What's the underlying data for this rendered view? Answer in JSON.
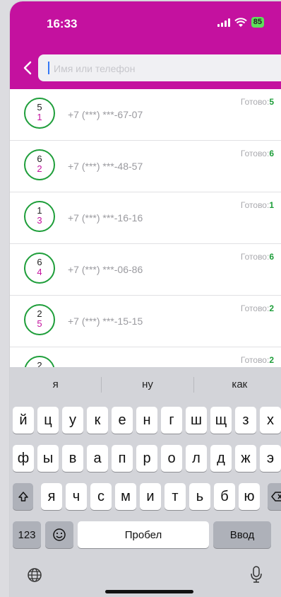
{
  "status_bar": {
    "time": "16:33",
    "battery": "85"
  },
  "search": {
    "placeholder": "Имя или телефон",
    "value": ""
  },
  "contacts": [
    {
      "count_top": "5",
      "count_bottom": "1",
      "phone": "+7 (***) ***-67-07",
      "status_label": "Готово:",
      "status_value": "5"
    },
    {
      "count_top": "6",
      "count_bottom": "2",
      "phone": "+7 (***) ***-48-57",
      "status_label": "Готово:",
      "status_value": "6"
    },
    {
      "count_top": "1",
      "count_bottom": "3",
      "phone": "+7 (***) ***-16-16",
      "status_label": "Готово:",
      "status_value": "1"
    },
    {
      "count_top": "6",
      "count_bottom": "4",
      "phone": "+7 (***) ***-06-86",
      "status_label": "Готово:",
      "status_value": "6"
    },
    {
      "count_top": "2",
      "count_bottom": "5",
      "phone": "+7 (***) ***-15-15",
      "status_label": "Готово:",
      "status_value": "2"
    },
    {
      "count_top": "2",
      "count_bottom": "",
      "phone": "",
      "status_label": "Готово:",
      "status_value": "2"
    }
  ],
  "keyboard": {
    "suggestions": [
      "я",
      "ну",
      "как"
    ],
    "row1": [
      "й",
      "ц",
      "у",
      "к",
      "е",
      "н",
      "г",
      "ш",
      "щ",
      "з",
      "х"
    ],
    "row2": [
      "ф",
      "ы",
      "в",
      "а",
      "п",
      "р",
      "о",
      "л",
      "д",
      "ж",
      "э"
    ],
    "row3": [
      "я",
      "ч",
      "с",
      "м",
      "и",
      "т",
      "ь",
      "б",
      "ю"
    ],
    "numbers_label": "123",
    "space_label": "Пробел",
    "return_label": "Ввод"
  },
  "colors": {
    "accent": "#c4119f",
    "status_green": "#1e9e3a"
  },
  "icons": [
    "back-chevron-icon",
    "signal-icon",
    "wifi-icon",
    "battery-icon",
    "shift-icon",
    "backspace-icon",
    "emoji-icon",
    "globe-icon",
    "microphone-icon"
  ]
}
